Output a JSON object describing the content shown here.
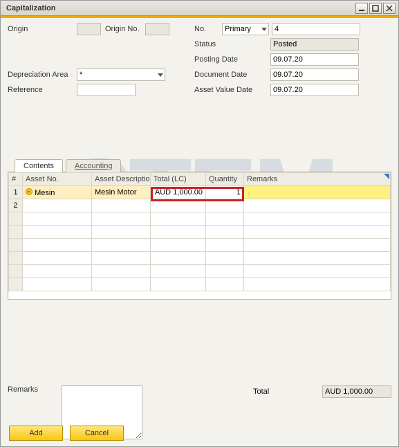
{
  "window": {
    "title": "Capitalization"
  },
  "header": {
    "origin_lbl": "Origin",
    "origin_no_lbl": "Origin No.",
    "depr_lbl": "Depreciation Area",
    "depr_value": "*",
    "ref_lbl": "Reference",
    "no_lbl": "No.",
    "no_sel_value": "Primary",
    "no_value": "4",
    "status_lbl": "Status",
    "status_value": "Posted",
    "posting_lbl": "Posting Date",
    "posting_value": "09.07.20",
    "docdate_lbl": "Document Date",
    "docdate_value": "09.07.20",
    "assetval_lbl": "Asset Value Date",
    "assetval_value": "09.07.20"
  },
  "tabs": {
    "contents": "Contents",
    "accounting": "Accounting"
  },
  "columns": {
    "num": "#",
    "asset_no": "Asset No.",
    "asset_desc": "Asset Description",
    "total_lc": "Total (LC)",
    "qty": "Quantity",
    "remarks": "Remarks"
  },
  "rows": [
    {
      "num": "1",
      "asset_no": "Mesin",
      "asset_desc": "Mesin Motor",
      "total_lc": "AUD 1,000.00",
      "qty": "1",
      "remarks": ""
    },
    {
      "num": "2",
      "asset_no": "",
      "asset_desc": "",
      "total_lc": "",
      "qty": "",
      "remarks": ""
    }
  ],
  "footer": {
    "remarks_lbl": "Remarks",
    "total_lbl": "Total",
    "total_value": "AUD 1,000.00",
    "add_btn": "Add",
    "cancel_btn": "Cancel"
  }
}
